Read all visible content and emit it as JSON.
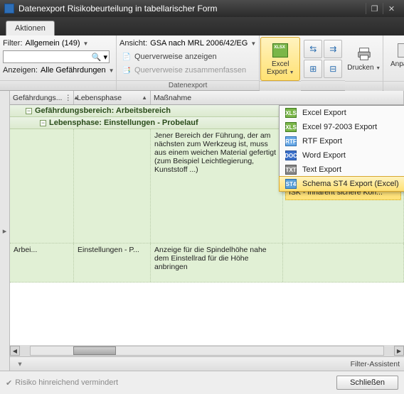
{
  "window": {
    "title": "Datenexport Risikobeurteilung in tabellarischer Form"
  },
  "tabs": {
    "main": "Aktionen"
  },
  "ribbon": {
    "filter_label": "Filter:",
    "filter_value": "Allgemein (149)",
    "anzeigen_label": "Anzeigen:",
    "anzeigen_value": "Alle Gefährdungen",
    "ansicht_label": "Ansicht:",
    "ansicht_value": "GSA nach MRL 2006/42/EG",
    "querverweise_anzeigen": "Querverweise anzeigen",
    "querverweise_zusammenfassen": "Querverweise zusammenfassen",
    "group_label": "Datenexport",
    "excel_export": "Excel Export",
    "drucken": "Drucken",
    "anpassen": "Anpassen"
  },
  "columns": {
    "c1": "Gefährdungs...",
    "c2": "Lebensphase",
    "c3": "Maßnahme"
  },
  "groups": {
    "bereich_label": "Gefährdungsbereich:",
    "bereich_value": "Arbeitsbereich",
    "phase_label": "Lebensphase:",
    "phase_value": "Einstellungen - Probelauf"
  },
  "rows": [
    {
      "c1": "",
      "c2": "",
      "massnahme": "Jener Bereich der Führung, der am nächsten zum Werkzeug ist, muss aus einem weichen Material gefertigt (zum Beispiel Leichtlegierung, Kunststoff ...)",
      "extra": "ISK - Inhärent sichere Kon..."
    },
    {
      "c1": "Arbei...",
      "c2": "Einstellungen - P...",
      "massnahme": "Anzeige für die Spindelhöhe nahe dem Einstellrad für die Höhe anbringen",
      "extra": ""
    }
  ],
  "dropdown": {
    "items": [
      "Excel Export",
      "Excel 97-2003 Export",
      "RTF Export",
      "Word Export",
      "Text Export",
      "Schema ST4 Export (Excel)"
    ]
  },
  "filterbar": {
    "label": "Filter-Assistent"
  },
  "footer": {
    "risk": "Risiko hinreichend vermindert",
    "close": "Schließen"
  }
}
